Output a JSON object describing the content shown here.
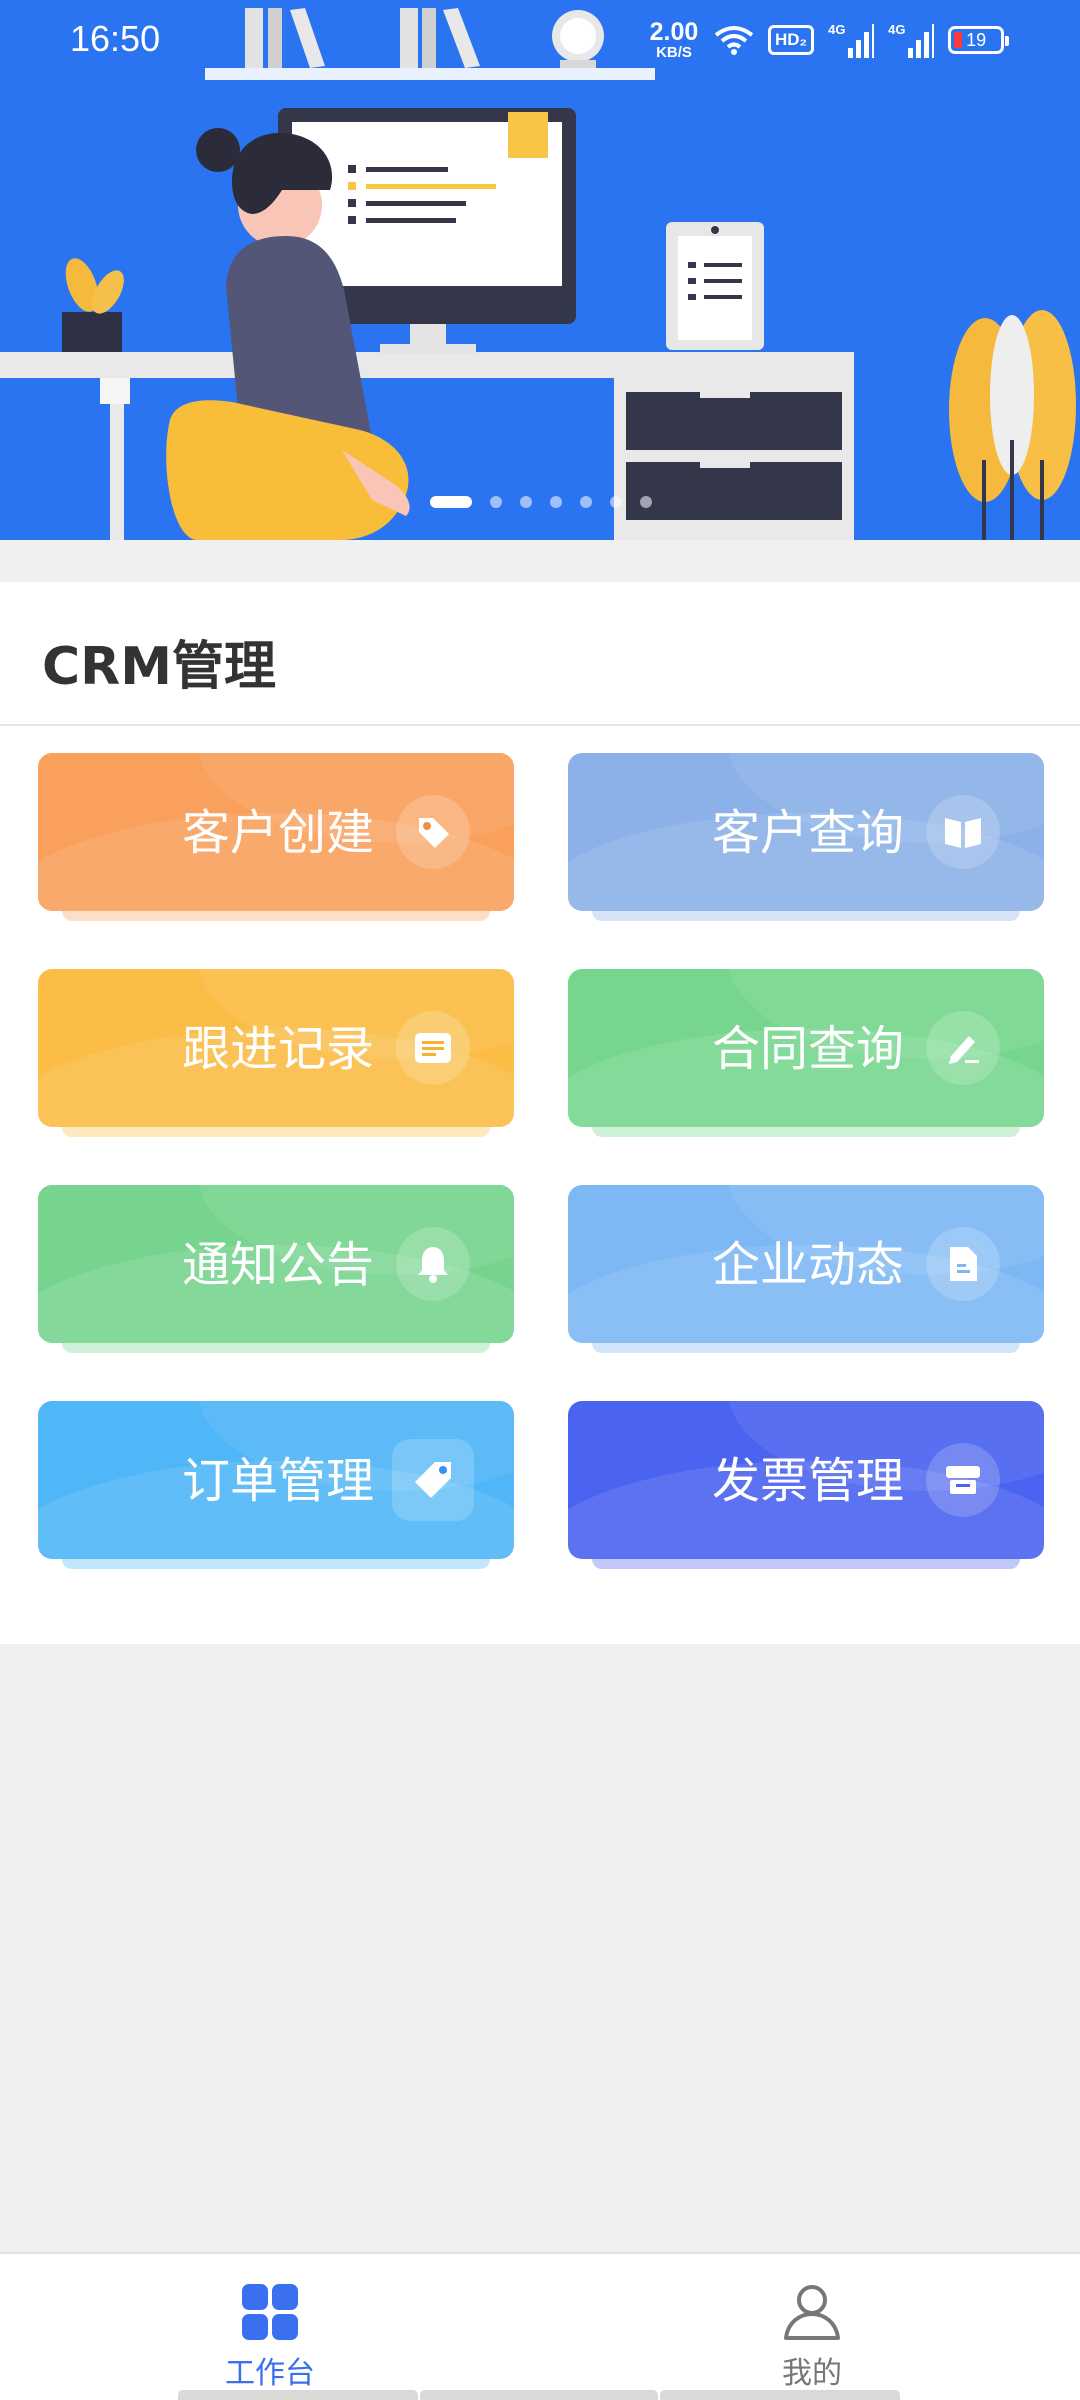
{
  "status_bar": {
    "time": "16:50",
    "net_speed_value": "2.00",
    "net_speed_unit": "KB/S",
    "hd_badge": "HD₂",
    "signal_1_label": "4G",
    "signal_2_label": "4G",
    "battery_level": "19"
  },
  "banner": {
    "slide_count": 7,
    "active_slide": 0
  },
  "section": {
    "title": "CRM管理"
  },
  "cards": [
    {
      "label": "客户创建",
      "icon": "tag-icon",
      "color": "#f9a05c"
    },
    {
      "label": "客户查询",
      "icon": "book-icon",
      "color": "#8bb1e8"
    },
    {
      "label": "跟进记录",
      "icon": "note-icon",
      "color": "#fbbd45"
    },
    {
      "label": "合同查询",
      "icon": "pen-icon",
      "color": "#76d68d"
    },
    {
      "label": "通知公告",
      "icon": "bell-icon",
      "color": "#76d48e"
    },
    {
      "label": "企业动态",
      "icon": "document-icon",
      "color": "#7db8f4"
    },
    {
      "label": "订单管理",
      "icon": "label-icon",
      "color": "#4fb6f7"
    },
    {
      "label": "发票管理",
      "icon": "invoice-icon",
      "color": "#4a63f0"
    }
  ],
  "bottom_nav": {
    "items": [
      {
        "label": "工作台",
        "icon": "grid-icon",
        "active": true
      },
      {
        "label": "我的",
        "icon": "person-icon",
        "active": false
      }
    ],
    "active_color": "#3a6ff0",
    "inactive_color": "#777777"
  }
}
